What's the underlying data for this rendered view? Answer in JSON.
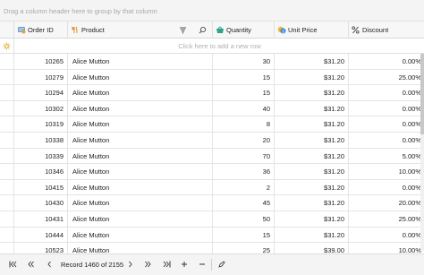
{
  "group_panel": {
    "hint": "Drag a column header here to group by that column"
  },
  "columns": {
    "order_id": "Order ID",
    "product": "Product",
    "quantity": "Quantity",
    "unit_price": "Unit Price",
    "discount": "Discount"
  },
  "new_row": {
    "hint": "Click here to add a new row"
  },
  "rows": [
    {
      "order_id": "10265",
      "product": "Alice Mutton",
      "quantity": "30",
      "unit_price": "$31.20",
      "discount": "0.00%"
    },
    {
      "order_id": "10279",
      "product": "Alice Mutton",
      "quantity": "15",
      "unit_price": "$31.20",
      "discount": "25.00%"
    },
    {
      "order_id": "10294",
      "product": "Alice Mutton",
      "quantity": "15",
      "unit_price": "$31.20",
      "discount": "0.00%"
    },
    {
      "order_id": "10302",
      "product": "Alice Mutton",
      "quantity": "40",
      "unit_price": "$31.20",
      "discount": "0.00%"
    },
    {
      "order_id": "10319",
      "product": "Alice Mutton",
      "quantity": "8",
      "unit_price": "$31.20",
      "discount": "0.00%"
    },
    {
      "order_id": "10338",
      "product": "Alice Mutton",
      "quantity": "20",
      "unit_price": "$31.20",
      "discount": "0.00%"
    },
    {
      "order_id": "10339",
      "product": "Alice Mutton",
      "quantity": "70",
      "unit_price": "$31.20",
      "discount": "5.00%"
    },
    {
      "order_id": "10346",
      "product": "Alice Mutton",
      "quantity": "36",
      "unit_price": "$31.20",
      "discount": "10.00%"
    },
    {
      "order_id": "10415",
      "product": "Alice Mutton",
      "quantity": "2",
      "unit_price": "$31.20",
      "discount": "0.00%"
    },
    {
      "order_id": "10430",
      "product": "Alice Mutton",
      "quantity": "45",
      "unit_price": "$31.20",
      "discount": "20.00%"
    },
    {
      "order_id": "10431",
      "product": "Alice Mutton",
      "quantity": "50",
      "unit_price": "$31.20",
      "discount": "25.00%"
    },
    {
      "order_id": "10444",
      "product": "Alice Mutton",
      "quantity": "15",
      "unit_price": "$31.20",
      "discount": "0.00%"
    },
    {
      "order_id": "10523",
      "product": "Alice Mutton",
      "quantity": "25",
      "unit_price": "$39.00",
      "discount": "10.00%"
    }
  ],
  "pager": {
    "record_text": "Record 1460 of 2155"
  },
  "icons": {
    "first": "first-record-icon",
    "prev_page": "previous-page-icon",
    "prev": "previous-record-icon",
    "next": "next-record-icon",
    "next_page": "next-page-icon",
    "last": "last-record-icon",
    "add": "add-record-icon",
    "delete": "delete-record-icon",
    "edit": "edit-record-icon"
  },
  "colors": {
    "accent": "#3b8ad8",
    "header_bg": "#f7f7f7",
    "grid_line": "#e4e4e4"
  }
}
